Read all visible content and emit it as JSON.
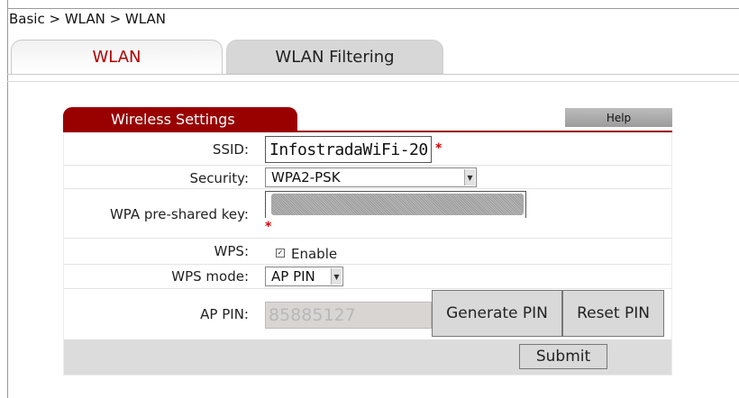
{
  "breadcrumb": "Basic > WLAN > WLAN",
  "tabs": [
    {
      "label": "WLAN",
      "active": true
    },
    {
      "label": "WLAN Filtering",
      "active": false
    }
  ],
  "panel": {
    "title": "Wireless Settings",
    "help_label": "Help"
  },
  "form": {
    "ssid_label": "SSID:",
    "ssid_value": "InfostradaWiFi-20",
    "required_mark": "*",
    "security_label": "Security:",
    "security_value": "WPA2-PSK",
    "psk_label": "WPA pre-shared key:",
    "wps_label": "WPS:",
    "wps_enable_label": "Enable",
    "wps_enabled": true,
    "wps_mode_label": "WPS mode:",
    "wps_mode_value": "AP PIN",
    "ap_pin_label": "AP PIN:",
    "ap_pin_value": "85885127",
    "generate_pin_label": "Generate PIN",
    "reset_pin_label": "Reset PIN",
    "submit_label": "Submit"
  },
  "colors": {
    "accent": "#990000",
    "active_tab_text": "#b30000",
    "required": "#d40000"
  }
}
